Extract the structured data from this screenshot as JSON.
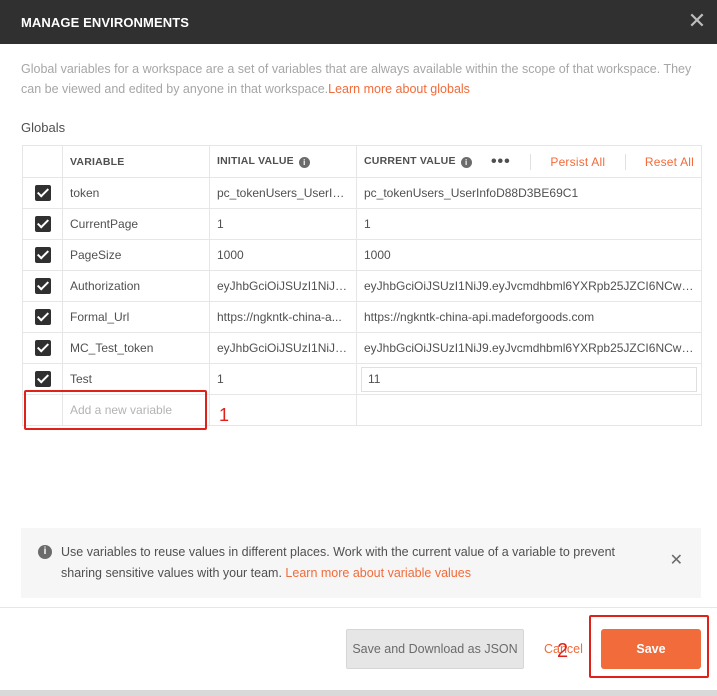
{
  "dialog": {
    "title": "MANAGE ENVIRONMENTS",
    "close_icon": "close-icon",
    "description": "Global variables for a workspace are a set of variables that are always available within the scope of that workspace. They can be viewed and edited by anyone in that workspace.",
    "description_link": "Learn more about globals",
    "section_title": "Globals"
  },
  "table": {
    "headers": {
      "variable": "VARIABLE",
      "initial_value": "INITIAL VALUE",
      "current_value": "CURRENT VALUE",
      "more": "•••",
      "persist_all": "Persist All",
      "reset_all": "Reset All"
    },
    "rows": [
      {
        "checked": true,
        "variable": "token",
        "initial": "pc_tokenUsers_UserIn...",
        "current": "pc_tokenUsers_UserInfoD88D3BE69C1"
      },
      {
        "checked": true,
        "variable": "CurrentPage",
        "initial": "1",
        "current": "1"
      },
      {
        "checked": true,
        "variable": "PageSize",
        "initial": "1000",
        "current": "1000"
      },
      {
        "checked": true,
        "variable": "Authorization",
        "initial": "eyJhbGciOiJSUzI1NiJ9....",
        "current": "eyJhbGciOiJSUzI1NiJ9.eyJvcmdhbml6YXRpb25JZCI6NCwiYX..."
      },
      {
        "checked": true,
        "variable": "Formal_Url",
        "initial": "https://ngkntk-china-a...",
        "current": "https://ngkntk-china-api.madeforgoods.com"
      },
      {
        "checked": true,
        "variable": "MC_Test_token",
        "initial": "eyJhbGciOiJSUzI1NiJ9....",
        "current": "eyJhbGciOiJSUzI1NiJ9.eyJvcmdhbml6YXRpb25JZCI6NCwiYX..."
      },
      {
        "checked": true,
        "variable": "Test",
        "initial": "1",
        "current": "11"
      }
    ],
    "new_variable_placeholder": "Add a new variable"
  },
  "annotations": {
    "marker_1": "1",
    "marker_2": "2",
    "color": "#e0211a"
  },
  "banner": {
    "text": "Use variables to reuse values in different places. Work with the current value of a variable to prevent sharing sensitive values with your team.",
    "link": "Learn more about variable values",
    "icon": "info-icon"
  },
  "footer": {
    "save_json": "Save and Download as JSON",
    "cancel": "Cancel",
    "save": "Save"
  },
  "colors": {
    "header_bg": "#303030",
    "accent": "#f26b3a"
  }
}
